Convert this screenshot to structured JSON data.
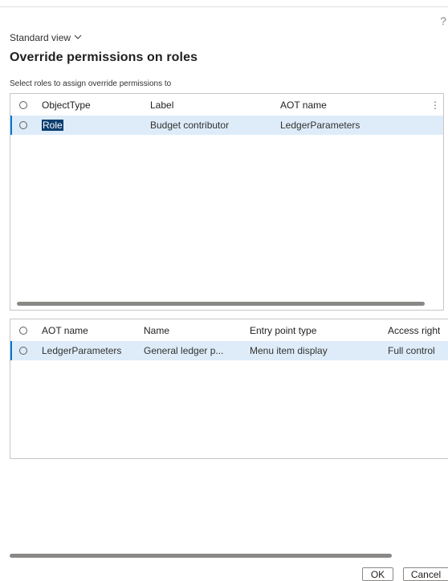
{
  "help_glyph": "?",
  "view": {
    "label": "Standard view"
  },
  "title": "Override permissions on roles",
  "roles_grid": {
    "caption": "Select roles to assign override permissions to",
    "columns": [
      "ObjectType",
      "Label",
      "AOT name"
    ],
    "rows": [
      {
        "object_type": "Role",
        "label": "Budget contributor",
        "aot_name": "LedgerParameters",
        "selected": true
      }
    ]
  },
  "permissions_grid": {
    "columns": [
      "AOT name",
      "Name",
      "Entry point type",
      "Access right"
    ],
    "rows": [
      {
        "aot_name": "LedgerParameters",
        "name": "General ledger p...",
        "entry_point_type": "Menu item display",
        "access_right": "Full control",
        "selected": true
      }
    ]
  },
  "buttons": {
    "ok": "OK",
    "cancel": "Cancel"
  },
  "colors": {
    "accent": "#0078d4",
    "selected_row": "#deecf9",
    "text_highlight": "#0b3e6f"
  }
}
